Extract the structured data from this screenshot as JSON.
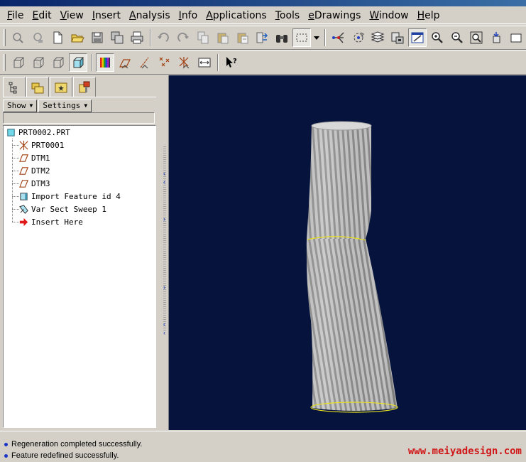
{
  "menu": [
    "File",
    "Edit",
    "View",
    "Insert",
    "Analysis",
    "Info",
    "Applications",
    "Tools",
    "eDrawings",
    "Window",
    "Help"
  ],
  "panel": {
    "show_label": "Show",
    "settings_label": "Settings",
    "tree": [
      {
        "label": "PRT0002.PRT",
        "icon": "part-icon"
      },
      {
        "label": "PRT0001",
        "icon": "csys-icon"
      },
      {
        "label": "DTM1",
        "icon": "datum-plane-icon"
      },
      {
        "label": "DTM2",
        "icon": "datum-plane-icon"
      },
      {
        "label": "DTM3",
        "icon": "datum-plane-icon"
      },
      {
        "label": "Import Feature id 4",
        "icon": "import-feature-icon"
      },
      {
        "label": "Var Sect Sweep 1",
        "icon": "sweep-icon"
      },
      {
        "label": "Insert Here",
        "icon": "insert-arrow-icon"
      }
    ]
  },
  "status": {
    "messages": [
      "Regeneration completed successfully.",
      "Feature redefined successfully."
    ]
  },
  "watermark": "www.meiyadesign.com",
  "colors": {
    "viewport_bg": "#05133d",
    "model": "#b8b8b8",
    "edge_highlight": "#e8e020",
    "watermark": "#d01818"
  }
}
